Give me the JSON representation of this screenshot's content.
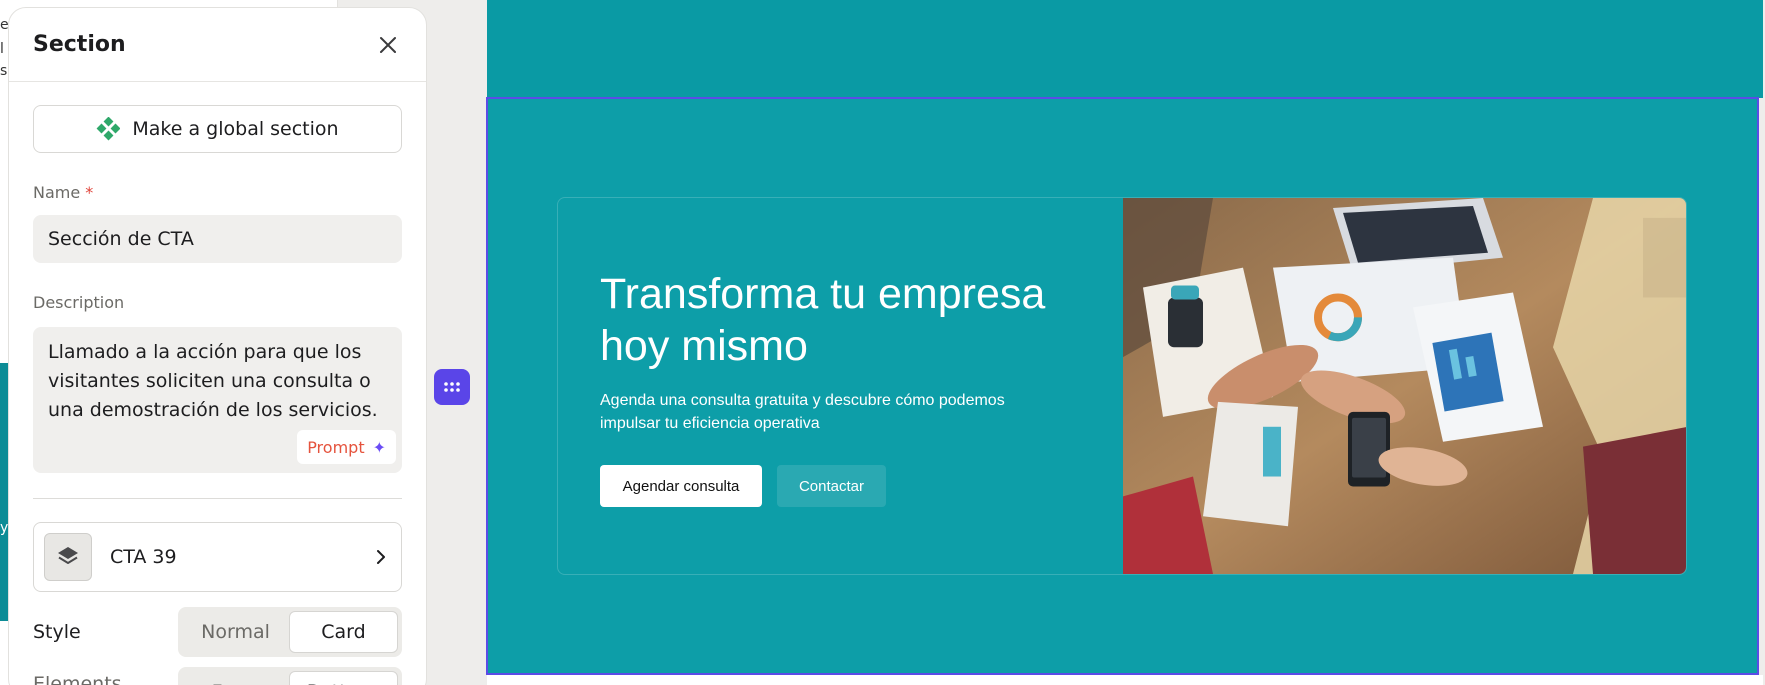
{
  "panel": {
    "title": "Section",
    "global_button_label": "Make a global section",
    "name_label": "Name",
    "name_required_mark": "*",
    "name_value": "Sección de CTA",
    "description_label": "Description",
    "description_value": "Llamado a la acción para que los visitantes soliciten una consulta o una demostración de los servicios.",
    "prompt_label": "Prompt",
    "template_name": "CTA 39",
    "style_label": "Style",
    "style_options": [
      "Normal",
      "Card"
    ],
    "style_selected": "Card",
    "next_row_label": "Elements",
    "next_row_options": [
      "Form",
      "Buttons"
    ]
  },
  "left_fragments": [
    "e",
    "l",
    "s",
    "y"
  ],
  "canvas": {
    "cta_title": "Transforma tu empresa hoy mismo",
    "cta_subtitle": "Agenda una consulta gratuita y descubre cómo podemos impulsar tu eficiencia operativa",
    "primary_button": "Agendar consulta",
    "secondary_button": "Contactar"
  },
  "colors": {
    "teal": "#0d9ea8",
    "selection": "#5b4ce6",
    "accent_green": "#2fa86a",
    "prompt_red": "#e5533d"
  }
}
